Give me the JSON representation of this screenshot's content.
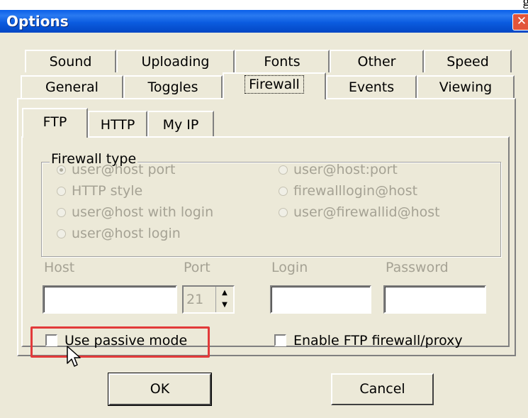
{
  "window": {
    "title": "Options",
    "close_glyph": "✕"
  },
  "tabs": {
    "row1": [
      {
        "label": "Sound"
      },
      {
        "label": "Uploading"
      },
      {
        "label": "Fonts"
      },
      {
        "label": "Other"
      },
      {
        "label": "Speed"
      }
    ],
    "row2": [
      {
        "label": "General"
      },
      {
        "label": "Toggles"
      },
      {
        "label": "Firewall"
      },
      {
        "label": "Events"
      },
      {
        "label": "Viewing"
      }
    ],
    "selected": "Firewall"
  },
  "subtabs": [
    {
      "label": "FTP"
    },
    {
      "label": "HTTP"
    },
    {
      "label": "My IP"
    }
  ],
  "subtab_selected": "FTP",
  "firewall_type": {
    "label": "Firewall type",
    "options": [
      {
        "label": "user@host port",
        "selected": true
      },
      {
        "label": "HTTP style",
        "selected": false
      },
      {
        "label": "user@host with login",
        "selected": false
      },
      {
        "label": "user@host login",
        "selected": false
      },
      {
        "label": "user@host:port",
        "selected": false
      },
      {
        "label": "firewalllogin@host",
        "selected": false
      },
      {
        "label": "user@firewallid@host",
        "selected": false
      }
    ],
    "enabled": false
  },
  "fields": {
    "host_label": "Host",
    "host_value": "",
    "port_label": "Port",
    "port_value": "21",
    "login_label": "Login",
    "login_value": "",
    "password_label": "Password",
    "password_value": ""
  },
  "checkboxes": {
    "passive": {
      "label": "Use passive mode",
      "checked": false
    },
    "enable_ftp_firewall": {
      "label": "Enable FTP firewall/proxy",
      "checked": false
    }
  },
  "buttons": {
    "ok": "OK",
    "cancel": "Cancel"
  },
  "cropped_text_top_right": "g",
  "colors": {
    "titlebar": "#0a5fe8",
    "window_bg": "#ece9d8",
    "highlight": "#e23a3a",
    "disabled_text": "#a5a294"
  }
}
